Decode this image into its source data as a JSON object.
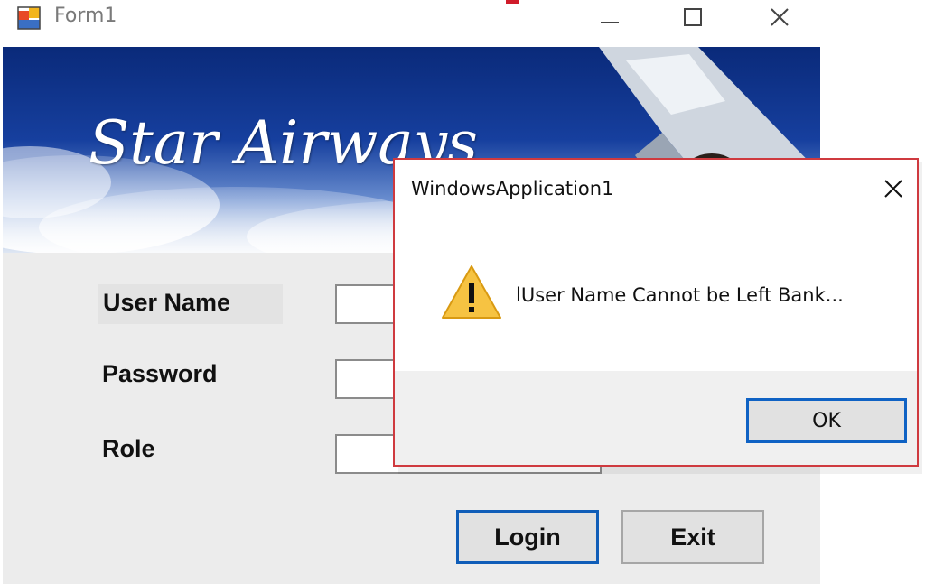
{
  "window": {
    "title": "Form1",
    "app_icon": "winforms-app-icon",
    "controls": [
      "minimize-icon",
      "maximize-icon",
      "close-icon"
    ]
  },
  "banner": {
    "brand_text": "Star Airways"
  },
  "form": {
    "user_name_label": "User Name",
    "password_label": "Password",
    "role_label": "Role",
    "user_name_value": "",
    "password_value": "",
    "role_value": "",
    "login_label": "Login",
    "exit_label": "Exit"
  },
  "dialog": {
    "title": "WindowsApplication1",
    "message": "lUser Name Cannot be Left Bank...",
    "icon": "warning-icon",
    "ok_label": "OK"
  },
  "colors": {
    "dialog_border": "#cf3a3f",
    "focus_blue": "#0f62c4",
    "warning_yellow": "#f6c342"
  }
}
